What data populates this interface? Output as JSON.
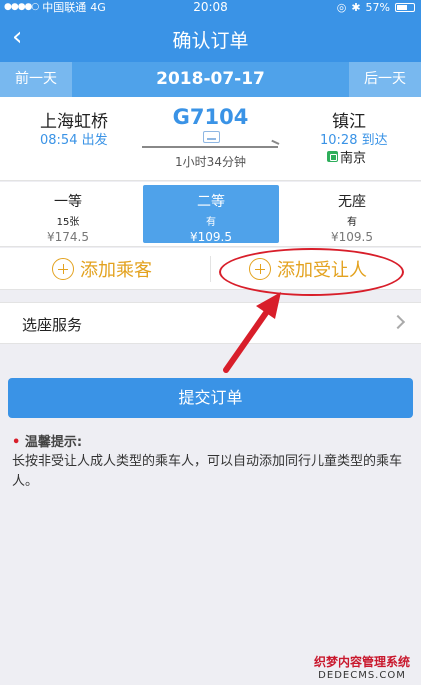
{
  "status": {
    "carrier": "中国联通",
    "network": "4G",
    "time": "20:08",
    "battery": "57%"
  },
  "nav": {
    "back_icon": "chevron-left-icon",
    "title": "确认订单"
  },
  "datebar": {
    "prev": "前一天",
    "date": "2018-07-17",
    "next": "后一天"
  },
  "train": {
    "from_station": "上海虹桥",
    "depart_time": "08:54 出发",
    "number": "G7104",
    "duration": "1小时34分钟",
    "to_station": "镇江",
    "arrive_time": "10:28 到达",
    "via": "南京"
  },
  "seats": [
    {
      "name": "一等",
      "count": "15张",
      "price": "¥174.5"
    },
    {
      "name": "二等",
      "count": "有",
      "price": "¥109.5"
    },
    {
      "name": "无座",
      "count": "有",
      "price": "¥109.5"
    }
  ],
  "actions": {
    "add_passenger": "添加乘客",
    "add_beneficiary": "添加受让人"
  },
  "service": {
    "label": "选座服务"
  },
  "submit": "提交订单",
  "tip": {
    "title": "温馨提示:",
    "body": "长按非受让人成人类型的乘车人，可以自动添加同行儿童类型的乘车人。"
  },
  "watermark": {
    "line1": "织梦内容管理系统",
    "line2": "DEDECMS.COM"
  },
  "colors": {
    "primary": "#3a93e6",
    "accent": "#e3a21f",
    "annotation": "#d81e2a"
  }
}
